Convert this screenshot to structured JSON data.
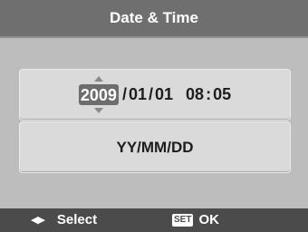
{
  "header": {
    "title": "Date & Time"
  },
  "datetime_row": {
    "year": "2009",
    "month": "01",
    "day": "01",
    "hour": "08",
    "minute": "05",
    "date_separator": "/",
    "time_separator": ":"
  },
  "format_row": {
    "label": "YY/MM/DD"
  },
  "footer": {
    "nav_icon": "left-right-arrows-icon",
    "nav_label": "Select",
    "set_icon_text": "SET",
    "ok_label": "OK"
  },
  "colors": {
    "title_bar": "#6f6f6f",
    "background": "#bdbdbd",
    "row_background": "#dadada",
    "selected_field": "#6d6d6d",
    "footer_bar": "#4b4b4b",
    "text_light": "#ffffff",
    "text_dark": "#1d1d1d"
  }
}
